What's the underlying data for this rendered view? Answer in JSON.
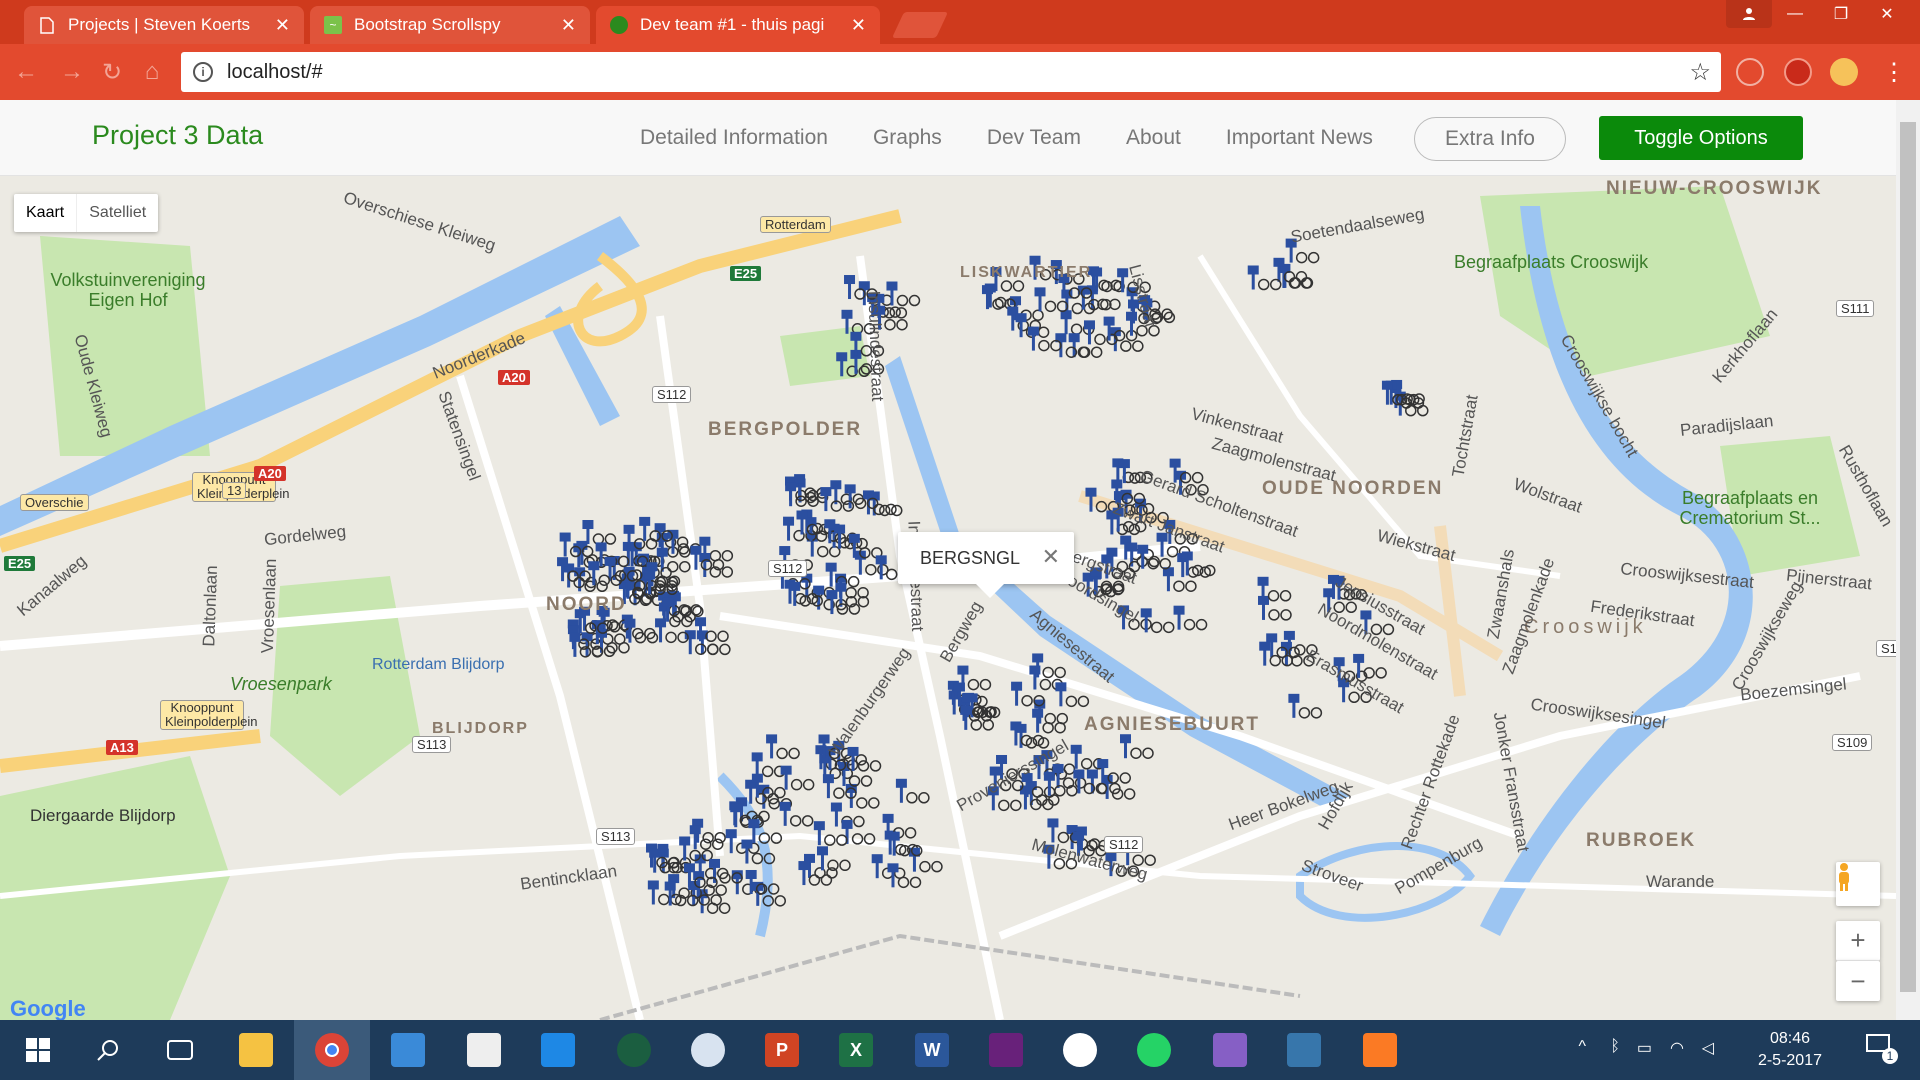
{
  "browser": {
    "tabs": [
      {
        "title": "Projects | Steven Koerts",
        "active": false
      },
      {
        "title": "Bootstrap Scrollspy",
        "active": false
      },
      {
        "title": "Dev team #1 - thuis pagi",
        "active": true
      }
    ],
    "url": "localhost/#"
  },
  "navbar": {
    "brand": "Project 3 Data",
    "links": [
      "Detailed Information",
      "Graphs",
      "Dev Team",
      "About",
      "Important News"
    ],
    "extra_info": "Extra Info",
    "toggle_options": "Toggle Options"
  },
  "map": {
    "map_type": {
      "map": "Kaart",
      "satellite": "Satelliet"
    },
    "info_window": {
      "text": "BERGSNGL",
      "close": "✕"
    },
    "areas": {
      "bergpolder": "BERGPOLDER",
      "noord": "NOORD",
      "agniesebuurt": "AGNIESEBUURT",
      "oude_noorden": "OUDE NOORDEN",
      "crooswijk": "Crooswijk",
      "nieuw_crooswijk": "NIEUW-CROOSWIJK",
      "rubroek": "RUBROEK",
      "liskwartier": "LISKWARTIER",
      "blijdorp": "BLIJDORP"
    },
    "places": {
      "volkstuin": "Volkstuinvereniging Eigen Hof",
      "diergaarde": "Diergaarde Blijdorp",
      "vroesenpark": "Vroesenpark",
      "begraafplaats_crooswijk": "Begraafplaats Crooswijk",
      "begraafplaats_crematorium": "Begraafplaats en Crematorium St...",
      "station": "Rotterdam Blijdorp",
      "knooppunt": "Knooppunt Kleinpolderplein",
      "overschie": "Overschie"
    },
    "streets": {
      "gordelweg": "Gordelweg",
      "noorderkade": "Noorderkade",
      "insulindestraat": "Insulindestraat",
      "vinkenstraat": "Vinkenstraat",
      "zaagmolenstraat": "Zaagmolenstraat",
      "zwart_janstraat": "Zwart Janstraat",
      "bergstraat": "Bergstraat",
      "jensiusstraat": "Jensiusstraat",
      "noordmolenstraat": "Noordmolenstraat",
      "erasmusstraat": "Erasmusstraat",
      "crooswijkseweg": "Crooswijksestraat",
      "frederikstraat": "Frederikstraat",
      "boezemsingel": "Boezemsingel",
      "crooswijksesingel": "Crooswijksesingel",
      "paradijslaan": "Paradijslaan",
      "kanaalweg": "Kanaalweg",
      "statensingel": "Statensingel",
      "bentincklaan": "Bentincklaan",
      "heer_bokelweg": "Heer Bokelweg",
      "warande": "Warande",
      "pijnerstraat": "Pijnerstraat",
      "wolstraat": "Wolstraat",
      "walenburgerweg": "Walenburgerweg",
      "provenierssingel": "Provenierssingel",
      "molenwaterweg": "Molenwaterweg",
      "overschiese": "Overschiese Kleiweg",
      "soetendaalseweg": "Soetendaalseweg",
      "stroveer": "Stroveer",
      "pompenburg": "Pompenburg",
      "kerkhoflaan": "Kerkhoflaan",
      "oude_kleiweg": "Oude Kleiweg",
      "vroesenlaan": "Vroesenlaan",
      "daltonlaan": "Daltonlaan",
      "tochtstraat": "Tochtstraat",
      "zwaanshals": "Zwaanshals",
      "zaagmolenkade": "Zaagmolenkade",
      "jonker_fransstraat": "Jonker Fransstraat",
      "rechter_rottekade": "Rechter Rottekade",
      "lisstraat": "Lisstraat",
      "gerard_scholtenstraat": "Gerard Scholtenstraat",
      "agniesestraat": "Agniesestraat",
      "bergweg": "Bergweg",
      "noordsingel": "Noordsingel",
      "noordplein": "Noordplein",
      "wiekstraat": "Wiekstraat",
      "crooswijkseweg2": "Crooswijkseweg",
      "rusthoflaan": "Rusthoflaan",
      "crooswijkse_bocht": "Crooswijkse bocht",
      "hofdijk": "Hofdijk"
    },
    "road_badges": {
      "s112": "S112",
      "s113": "S113",
      "s111": "S111",
      "s109": "S109",
      "s1": "S1",
      "a20": "A20",
      "a13": "A13",
      "e25": "E25",
      "n13": "13",
      "rotterdam": "Rotterdam"
    },
    "google": "Google",
    "zoom_in": "+",
    "zoom_out": "−"
  },
  "taskbar": {
    "time": "08:46",
    "date": "2-5-2017",
    "notifications": "1"
  },
  "colors": {
    "chrome": "#cf3a1d",
    "brand": "#2b8a1e",
    "toggle": "#0b8a0b",
    "marker": "#2b4fa0"
  }
}
